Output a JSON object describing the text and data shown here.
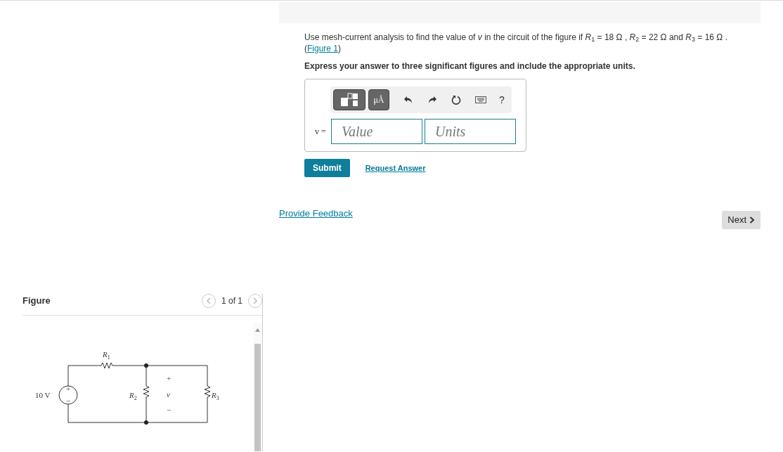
{
  "figure_panel": {
    "title": "Figure",
    "pager": "1 of 1",
    "prev_disabled": true,
    "next_disabled": true,
    "labels": {
      "r1": "R$_{1}$",
      "r2": "R$_{2}$",
      "r3": "R$_{3}$",
      "source": "10 V",
      "source_plus": "+",
      "source_minus": "−",
      "v_plus": "+",
      "v": "v",
      "v_minus": "−"
    }
  },
  "question": {
    "before": "Use mesh-current analysis to find the value of *v* in the circuit of the figure if *R*$_{1}$ = 18 Ω , *R*$_{2}$ = 22 Ω and *R*$_{3}$ = 16 Ω . (",
    "link": "Figure 1",
    "after": ")"
  },
  "instruction": "Express your answer to three significant figures and include the appropriate units.",
  "answer_box": {
    "toolbar": {
      "units_button": "μÅ",
      "help": "?"
    },
    "variable": "v =",
    "value_placeholder": "Value",
    "units_placeholder": "Units"
  },
  "buttons": {
    "submit": "Submit",
    "request": "Request Answer"
  },
  "feedback_link": "Provide Feedback",
  "next_button": "Next"
}
